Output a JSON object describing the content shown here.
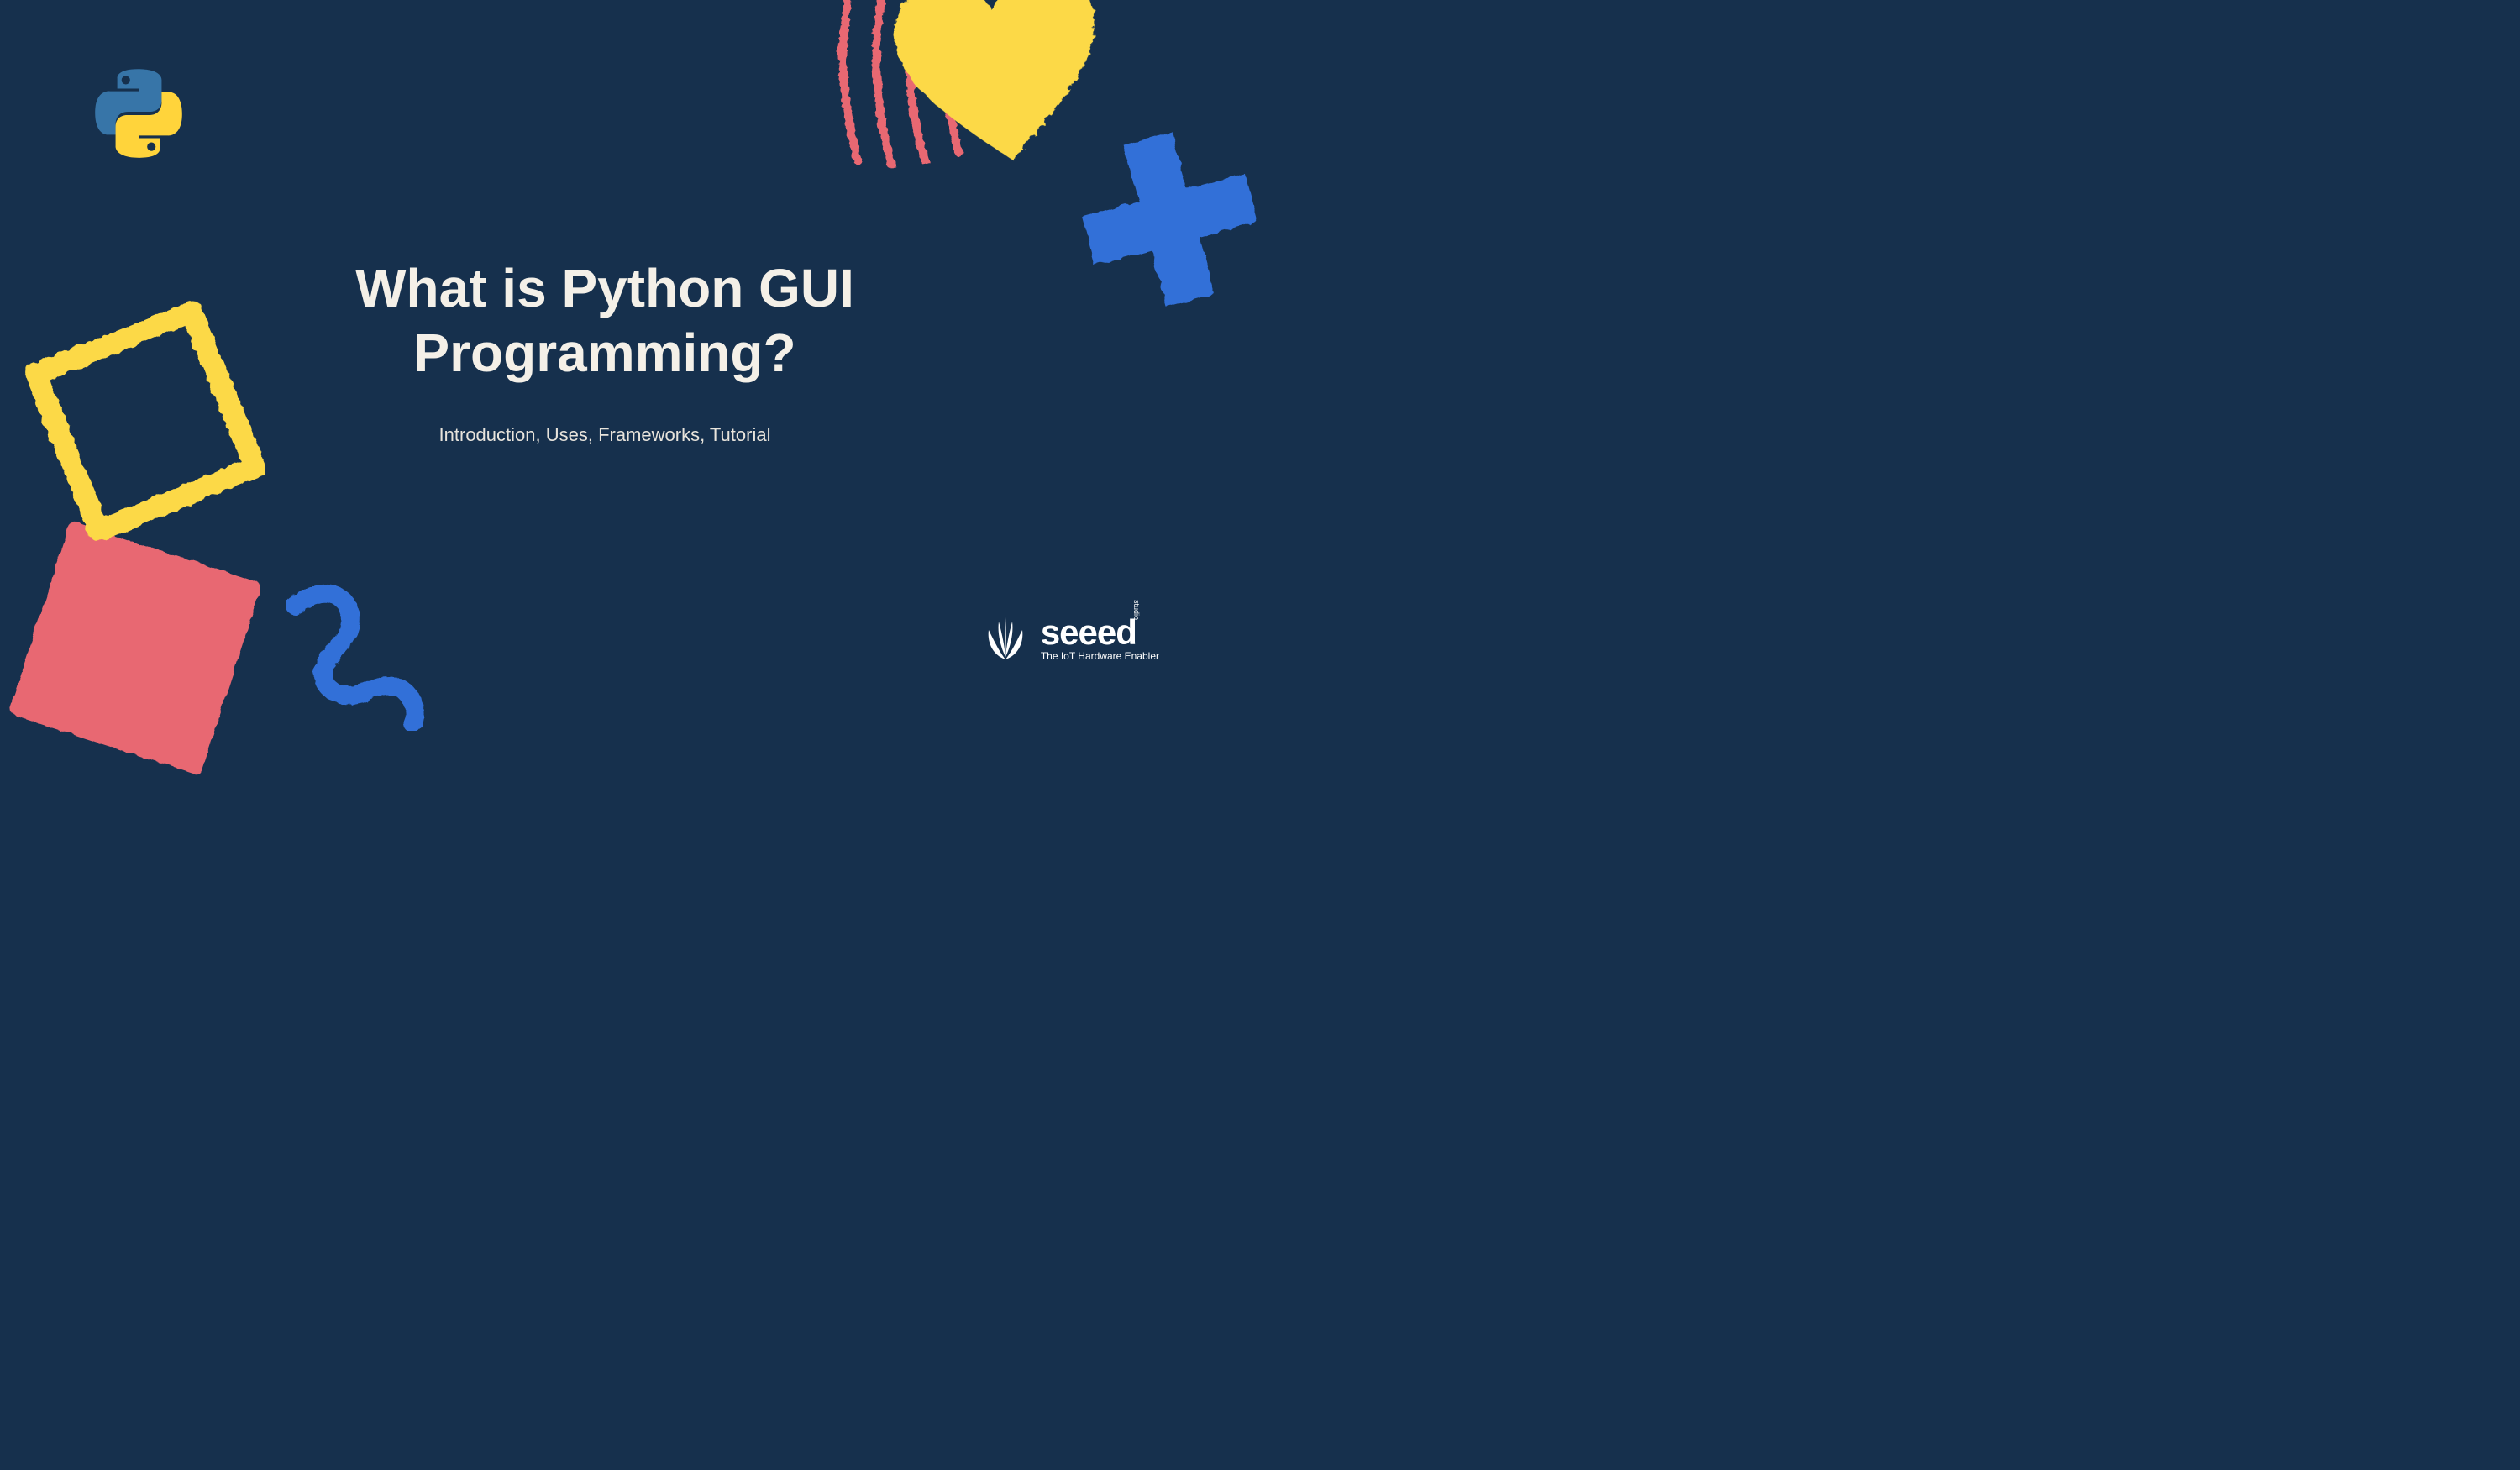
{
  "title": "What is Python GUI Programming?",
  "subtitle": "Introduction, Uses, Frameworks, Tutorial",
  "logo": {
    "brand": "seeed",
    "tagline": "The IoT Hardware Enabler",
    "side_label": "studio"
  },
  "colors": {
    "background": "#16304d",
    "title_text": "#f4f0e8",
    "yellow": "#fcd947",
    "pink": "#e86772",
    "blue": "#3070d8",
    "python_blue": "#3775a8",
    "python_yellow": "#ffd43b"
  }
}
